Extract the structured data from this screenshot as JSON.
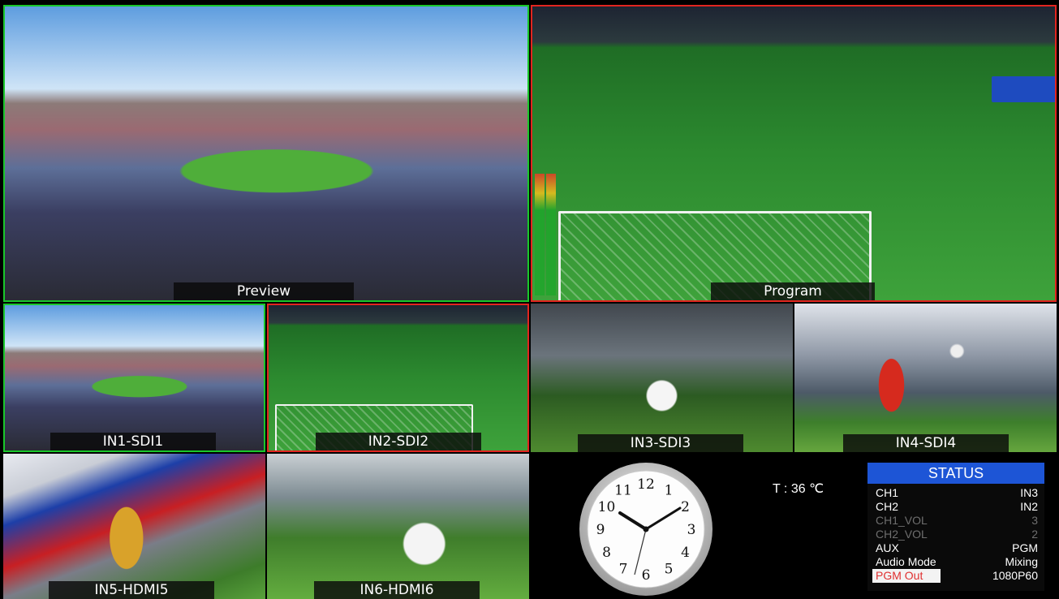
{
  "multiview": {
    "preview_label": "Preview",
    "program_label": "Program",
    "inputs": [
      {
        "label": "IN1-SDI1"
      },
      {
        "label": "IN2-SDI2"
      },
      {
        "label": "IN3-SDI3"
      },
      {
        "label": "IN4-SDI4"
      },
      {
        "label": "IN5-HDMI5"
      },
      {
        "label": "IN6-HDMI6"
      }
    ],
    "tally_colors": {
      "preview": "#19c82a",
      "program": "#e2251f"
    }
  },
  "clock": {
    "numbers": [
      "12",
      "1",
      "2",
      "3",
      "4",
      "5",
      "6",
      "7",
      "8",
      "9",
      "10",
      "11"
    ]
  },
  "temperature": "T : 36 ℃",
  "status": {
    "title": "STATUS",
    "rows": [
      {
        "key": "CH1",
        "value": "IN3"
      },
      {
        "key": "CH2",
        "value": "IN2"
      },
      {
        "key": "CH1_VOL",
        "value": "3"
      },
      {
        "key": "CH2_VOL",
        "value": "2"
      },
      {
        "key": "AUX",
        "value": "PGM"
      },
      {
        "key": "Audio Mode",
        "value": "Mixing"
      },
      {
        "key": "PGM Out",
        "value": "1080P60"
      }
    ]
  }
}
